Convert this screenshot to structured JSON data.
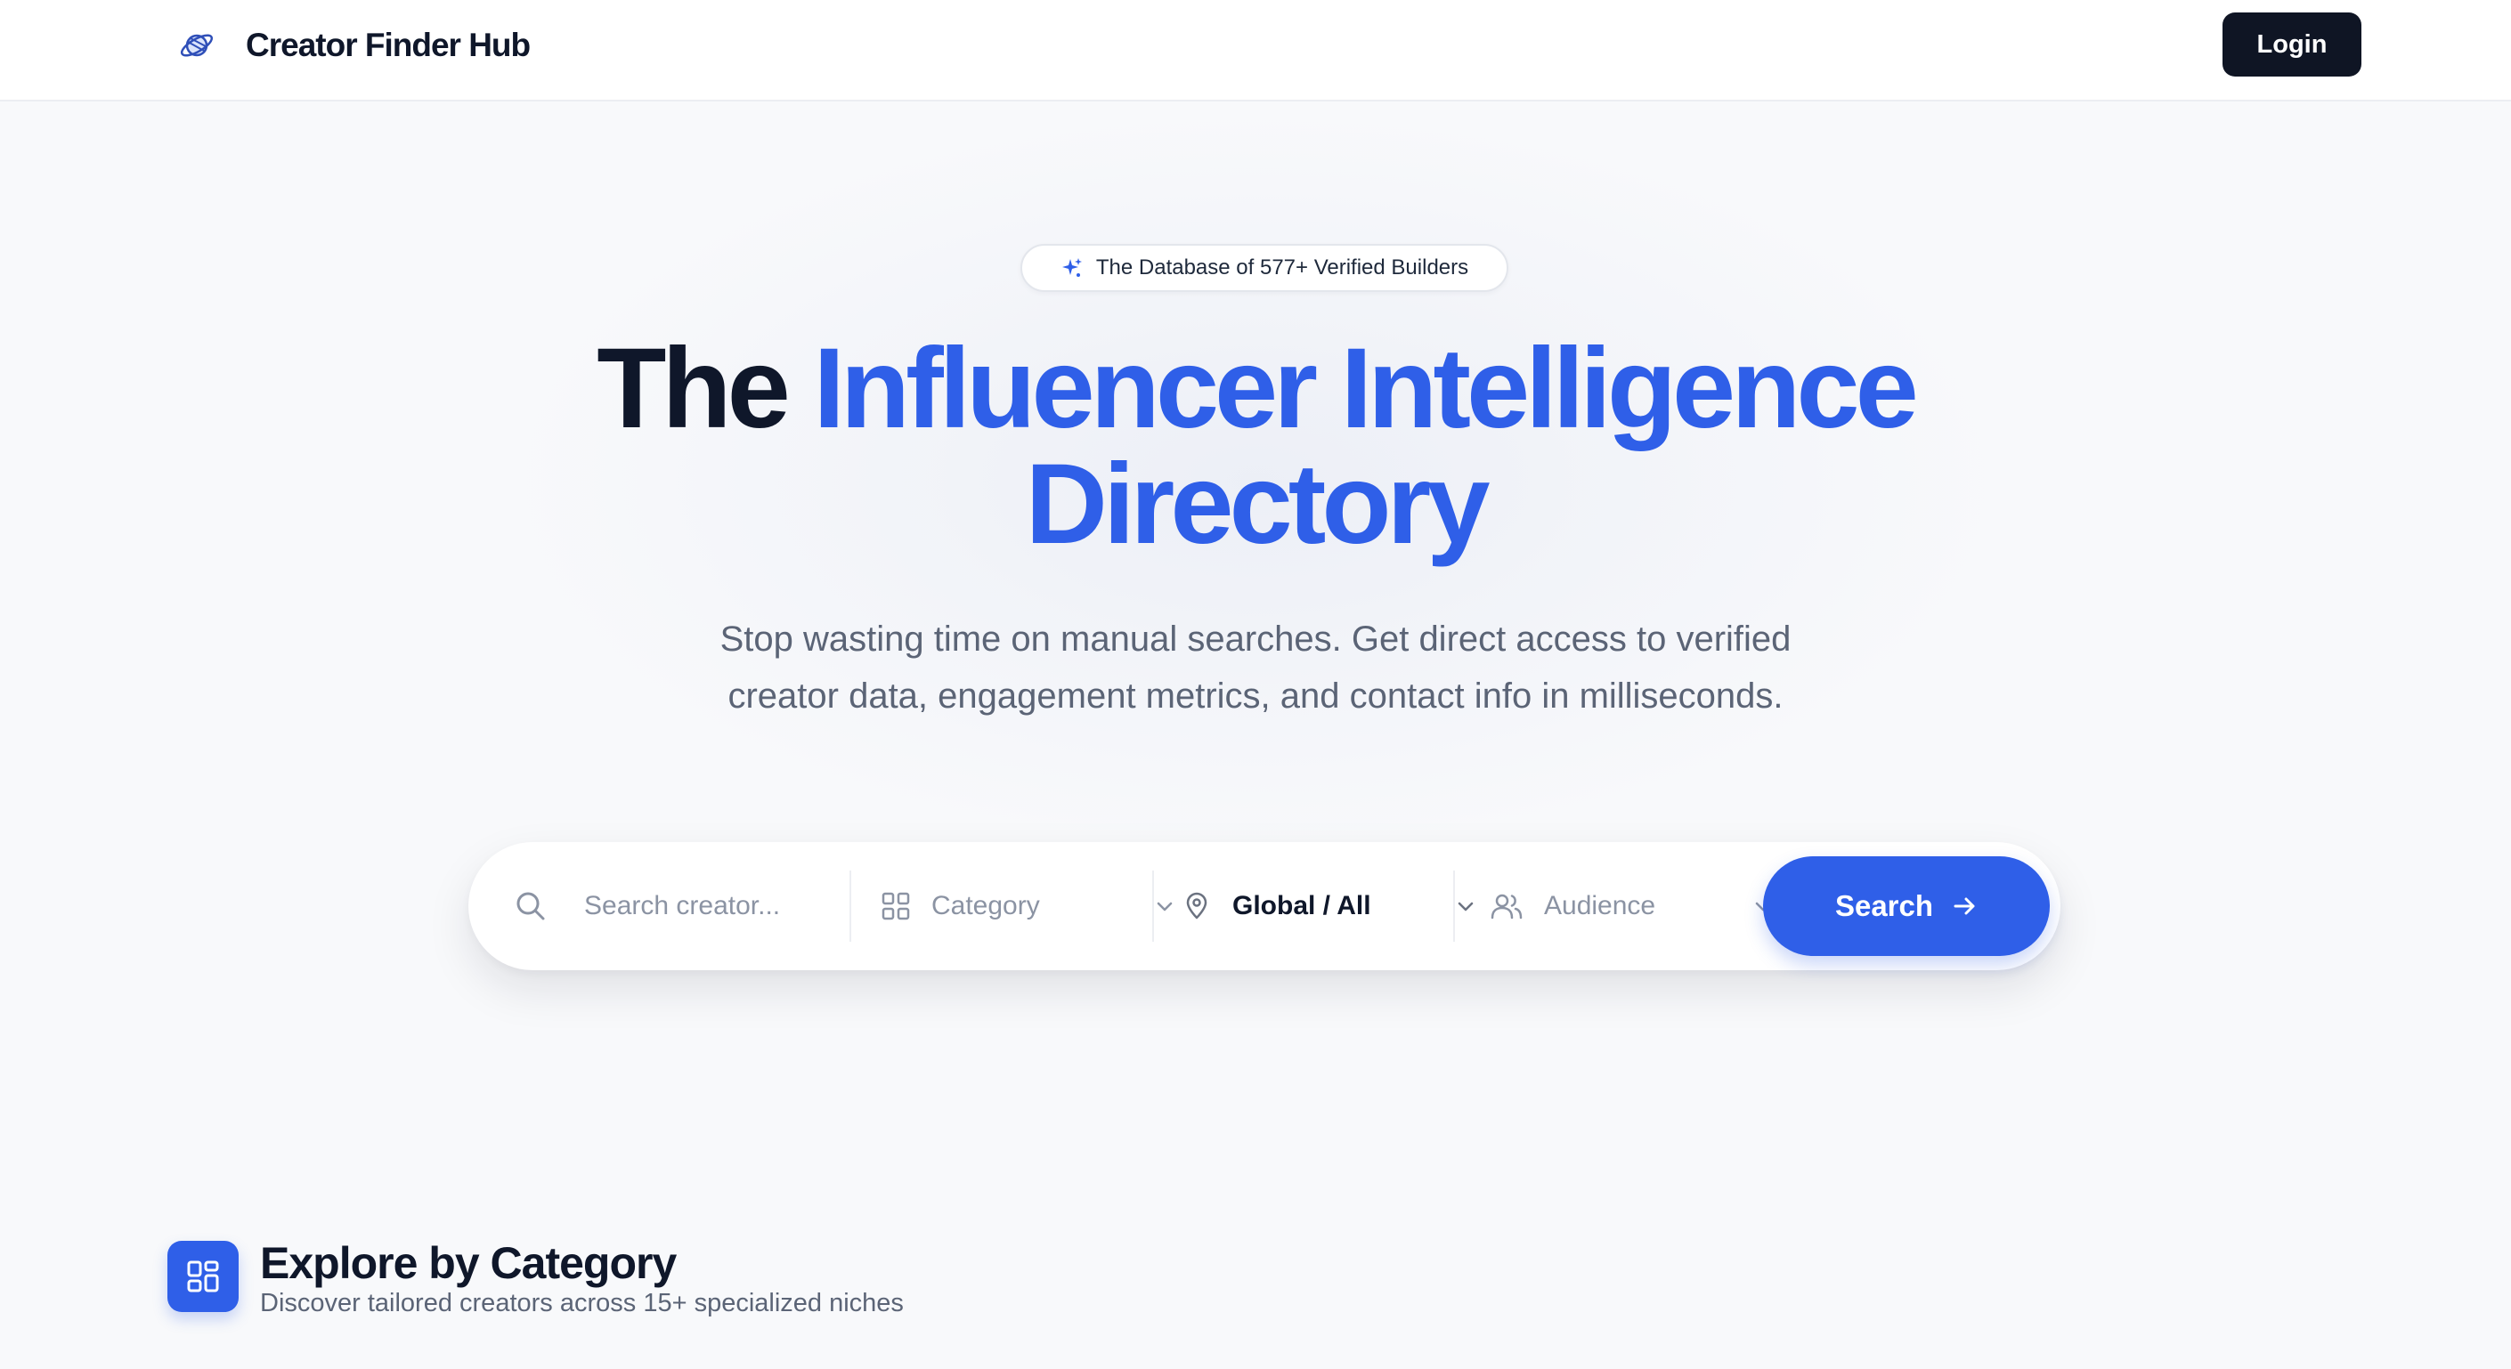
{
  "navbar": {
    "brand": "Creator Finder Hub",
    "logo_icon": "planet-icon",
    "login_label": "Login"
  },
  "hero": {
    "badge_icon": "sparkle-icon",
    "badge_text": "The Database of 577+ Verified Builders",
    "headline_dark": "The",
    "headline_blue_line1": "Influencer Intelligence",
    "headline_blue_line2": "Directory",
    "subtitle_line1": "Stop wasting time on manual searches. Get direct access to verified",
    "subtitle_line2": "creator data, engagement metrics, and contact info in milliseconds."
  },
  "search": {
    "placeholder": "Search creator...",
    "category_label": "Category",
    "location_value": "Global / All",
    "audience_label": "Audience",
    "button_label": "Search",
    "icons": [
      "search-icon",
      "grid-icon",
      "map-pin-icon",
      "users-icon",
      "chevron-down-icon",
      "arrow-right-icon"
    ]
  },
  "category_section": {
    "title": "Explore by Category",
    "subtitle": "Discover tailored creators across 15+ specialized niches",
    "icon": "grid-icon"
  },
  "colors": {
    "accent": "#2f5fe8",
    "dark": "#0f172a",
    "login_bg": "#0f1524",
    "background": "#f8f9fb"
  }
}
